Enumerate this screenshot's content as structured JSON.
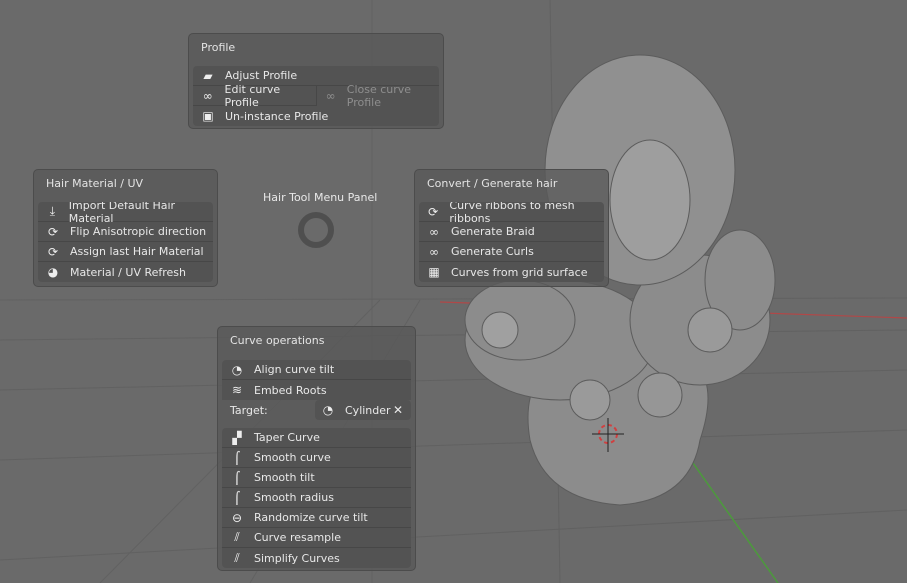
{
  "center": {
    "title": "Hair Tool Menu Panel"
  },
  "profile": {
    "title": "Profile",
    "adjust": "Adjust Profile",
    "edit": "Edit curve Profile",
    "close": "Close curve Profile",
    "uninstance": "Un-instance Profile"
  },
  "material": {
    "title": "Hair Material / UV",
    "items": [
      "Import Default Hair Material",
      "Flip Anisotropic direction",
      "Assign last Hair Material",
      "Material / UV Refresh"
    ]
  },
  "convert": {
    "title": "Convert / Generate hair",
    "items": [
      "Curve ribbons to mesh ribbons",
      "Generate Braid",
      "Generate Curls",
      "Curves from grid surface"
    ]
  },
  "curveops": {
    "title": "Curve operations",
    "align": "Align curve tilt",
    "embed": "Embed Roots",
    "target_label": "Target:",
    "target_value": "Cylinder",
    "items": [
      "Taper Curve",
      "Smooth curve",
      "Smooth tilt",
      "Smooth radius",
      "Randomize curve tilt",
      "Curve resample",
      "Simplify Curves"
    ]
  },
  "colors": {
    "x_axis": "#b04848",
    "y_axis": "#4c9a3c",
    "viewport": "#6a6a6a"
  }
}
